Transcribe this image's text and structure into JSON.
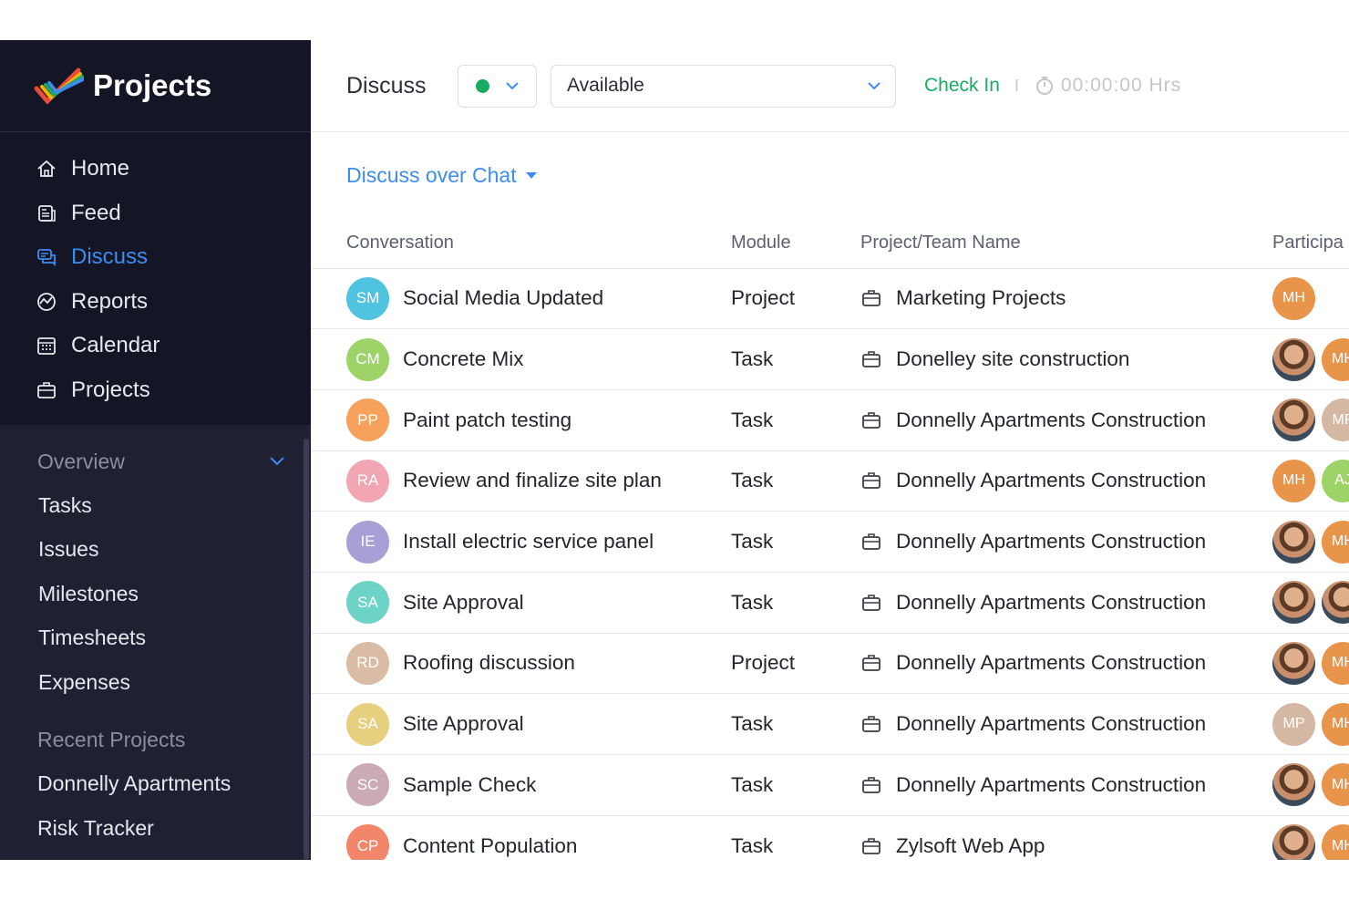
{
  "brand": {
    "name": "Projects"
  },
  "nav": [
    {
      "id": "home",
      "label": "Home",
      "icon": "home-icon",
      "active": false
    },
    {
      "id": "feed",
      "label": "Feed",
      "icon": "feed-icon",
      "active": false
    },
    {
      "id": "discuss",
      "label": "Discuss",
      "icon": "discuss-icon",
      "active": true
    },
    {
      "id": "reports",
      "label": "Reports",
      "icon": "reports-icon",
      "active": false
    },
    {
      "id": "calendar",
      "label": "Calendar",
      "icon": "calendar-icon",
      "active": false
    },
    {
      "id": "projects",
      "label": "Projects",
      "icon": "briefcase-icon",
      "active": false
    }
  ],
  "overview": {
    "label": "Overview",
    "items": [
      "Tasks",
      "Issues",
      "Milestones",
      "Timesheets",
      "Expenses"
    ]
  },
  "recent": {
    "label": "Recent Projects",
    "items": [
      "Donnelly Apartments",
      "Risk Tracker"
    ]
  },
  "header": {
    "title": "Discuss",
    "status_color": "#1aab62",
    "availability": "Available",
    "check_in": "Check In",
    "separator": "I",
    "timer": "00:00:00 Hrs"
  },
  "view": {
    "label": "Discuss over Chat"
  },
  "table": {
    "columns": {
      "conversation": "Conversation",
      "module": "Module",
      "project": "Project/Team Name",
      "participants": "Participa"
    },
    "rows": [
      {
        "initials": "SM",
        "color": "#4fc3e0",
        "title": "Social Media Updated",
        "module": "Project",
        "project": "Marketing Projects",
        "participants": [
          {
            "type": "initials",
            "text": "MH",
            "color": "#e8944a"
          }
        ]
      },
      {
        "initials": "CM",
        "color": "#9ed36a",
        "title": "Concrete Mix",
        "module": "Task",
        "project": "Donelley site construction",
        "participants": [
          {
            "type": "photo"
          },
          {
            "type": "initials",
            "text": "MH",
            "color": "#e8944a"
          }
        ]
      },
      {
        "initials": "PP",
        "color": "#f7a25c",
        "title": "Paint patch testing",
        "module": "Task",
        "project": "Donnelly Apartments Construction",
        "participants": [
          {
            "type": "photo"
          },
          {
            "type": "initials",
            "text": "MP",
            "color": "#d4b8a4"
          }
        ]
      },
      {
        "initials": "RA",
        "color": "#f2a6b4",
        "title": "Review and finalize site plan",
        "module": "Task",
        "project": "Donnelly Apartments Construction",
        "participants": [
          {
            "type": "initials",
            "text": "MH",
            "color": "#e8944a"
          },
          {
            "type": "initials",
            "text": "AJ",
            "color": "#9ed36a"
          }
        ]
      },
      {
        "initials": "IE",
        "color": "#a99ed6",
        "title": "Install electric service panel",
        "module": "Task",
        "project": "Donnelly Apartments Construction",
        "participants": [
          {
            "type": "photo"
          },
          {
            "type": "initials",
            "text": "MH",
            "color": "#e8944a"
          }
        ]
      },
      {
        "initials": "SA",
        "color": "#6dd3c6",
        "title": "Site Approval",
        "module": "Task",
        "project": "Donnelly Apartments Construction",
        "participants": [
          {
            "type": "photo"
          },
          {
            "type": "photo"
          }
        ]
      },
      {
        "initials": "RD",
        "color": "#d9bba6",
        "title": "Roofing discussion",
        "module": "Project",
        "project": "Donnelly Apartments Construction",
        "participants": [
          {
            "type": "photo"
          },
          {
            "type": "initials",
            "text": "MH",
            "color": "#e8944a"
          }
        ]
      },
      {
        "initials": "SA",
        "color": "#e6cf7e",
        "title": "Site Approval",
        "module": "Task",
        "project": "Donnelly Apartments Construction",
        "participants": [
          {
            "type": "initials",
            "text": "MP",
            "color": "#d4b8a4"
          },
          {
            "type": "initials",
            "text": "MH",
            "color": "#e8944a"
          }
        ]
      },
      {
        "initials": "SC",
        "color": "#c9aab6",
        "title": "Sample Check",
        "module": "Task",
        "project": "Donnelly Apartments Construction",
        "participants": [
          {
            "type": "photo"
          },
          {
            "type": "initials",
            "text": "MH",
            "color": "#e8944a"
          }
        ]
      },
      {
        "initials": "CP",
        "color": "#f2866a",
        "title": "Content Population",
        "module": "Task",
        "project": "Zylsoft Web App",
        "participants": [
          {
            "type": "photo"
          },
          {
            "type": "initials",
            "text": "MH",
            "color": "#e8944a"
          }
        ]
      }
    ]
  }
}
